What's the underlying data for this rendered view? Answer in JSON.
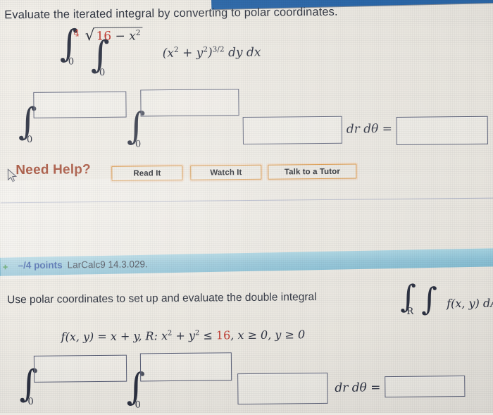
{
  "window": {
    "chrome_color": "#2b67a8"
  },
  "question1": {
    "prompt": "Evaluate the iterated integral by converting to polar coordinates.",
    "integral": {
      "outer_lower": "0",
      "outer_upper": "4",
      "inner_lower": "0",
      "inner_upper_radicand_a": "16",
      "inner_upper_radicand_b": "x",
      "inner_upper_radicand_exp": "2",
      "radical_glyph": "√",
      "integral_glyph": "∫",
      "integrand": "(x",
      "integrand_exp1": "2",
      "integrand_mid": " + y",
      "integrand_exp2": "2",
      "integrand_close": ")",
      "integrand_power": "3/2",
      "differentials": " dy dx"
    },
    "answer_integral": {
      "outer_lower": "0",
      "inner_lower": "0",
      "integral_glyph": "∫",
      "dr_dtheta": "dr dθ ="
    },
    "answer_boxes": {
      "outer_upper": "",
      "inner_upper": "",
      "integrand": "",
      "result": ""
    },
    "help": {
      "label": "Need Help?",
      "buttons": [
        {
          "label": "Read It"
        },
        {
          "label": "Watch It"
        },
        {
          "label": "Talk to a Tutor"
        }
      ]
    }
  },
  "question2": {
    "points_bar": {
      "expand_icon": "+",
      "points": "–/4 points",
      "reference": "LarCalc9 14.3.029.",
      "background_color": "#8fc3d6"
    },
    "prompt": "Use polar coordinates to set up and evaluate the double integral",
    "double_integral": {
      "integral_glyph": "∫",
      "region_label": "R",
      "integrand": "f(x, y) dA."
    },
    "function_definition": {
      "prefix": "f(x, y) = x + y, R: x",
      "exp1": "2",
      "mid": " + y",
      "exp2": "2",
      "relation": " ≤ ",
      "radius_squared": "16",
      "suffix": ", x ≥ 0, y ≥ 0"
    },
    "answer_integral": {
      "outer_lower": "0",
      "inner_lower": "0",
      "integral_glyph": "∫",
      "dr_dtheta": "dr dθ ="
    },
    "answer_boxes": {
      "outer_upper": "",
      "inner_upper": "",
      "integrand": "",
      "result": ""
    }
  },
  "colors": {
    "accent_red": "#c0392f",
    "points_blue": "#20489c",
    "help_label": "#a9553f",
    "button_orange": "#e8a757"
  }
}
